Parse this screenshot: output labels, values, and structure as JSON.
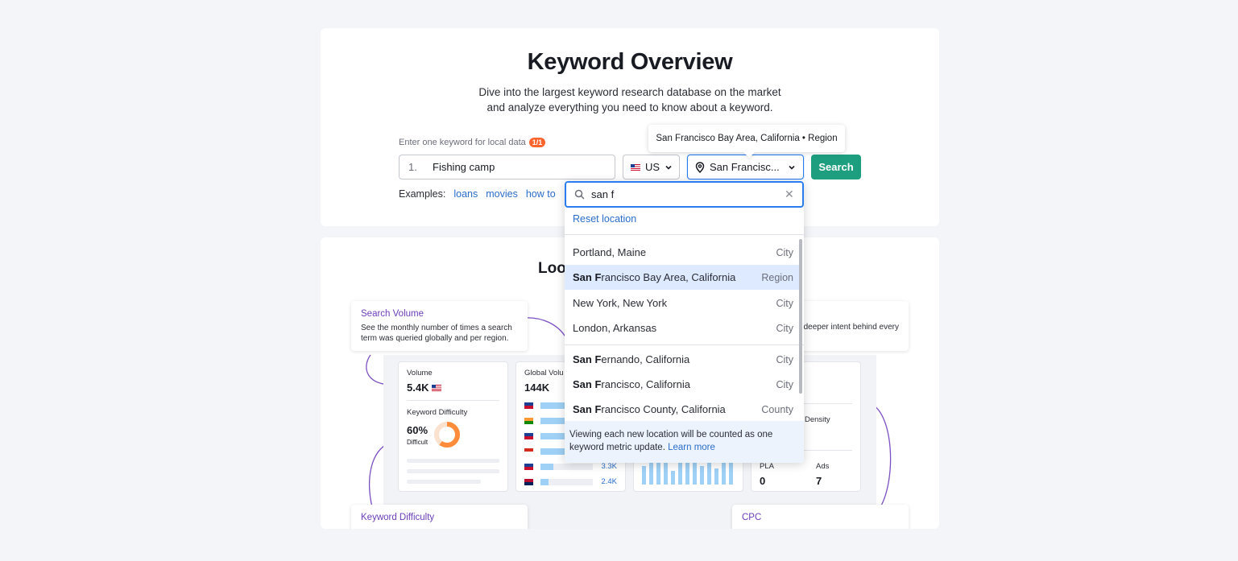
{
  "header": {
    "title": "Keyword Overview",
    "subtitle_line1": "Dive into the largest keyword research database on the market",
    "subtitle_line2": "and analyze everything you need to know about a keyword."
  },
  "form": {
    "label": "Enter one keyword for local data",
    "badge": "1/1",
    "row_number": "1.",
    "keyword_value": "Fishing camp",
    "country": "US",
    "location": "San Francisc...",
    "search_label": "Search",
    "examples_label": "Examples:",
    "examples": [
      "loans",
      "movies",
      "how to"
    ]
  },
  "tooltip": {
    "text": "San Francisco Bay Area, California • Region"
  },
  "dropdown": {
    "query": "san f",
    "reset_label": "Reset location",
    "items": [
      {
        "pre": "",
        "bold": "",
        "rest": "Portland, Maine",
        "type": "City"
      },
      {
        "pre": "",
        "bold": "San F",
        "rest": "rancisco Bay Area, California",
        "type": "Region"
      },
      {
        "pre": "",
        "bold": "",
        "rest": "New York, New York",
        "type": "City"
      },
      {
        "pre": "",
        "bold": "",
        "rest": "London, Arkansas",
        "type": "City"
      },
      {
        "pre": "",
        "bold": "San F",
        "rest": "ernando, California",
        "type": "City"
      },
      {
        "pre": "",
        "bold": "San F",
        "rest": "rancisco, California",
        "type": "City"
      },
      {
        "pre": "",
        "bold": "San F",
        "rest": "rancisco County, California",
        "type": "County"
      }
    ],
    "note_text": "Viewing each new location will be counted as one keyword metric update.",
    "note_link": "Learn more"
  },
  "bottom": {
    "title_partial": "Loo",
    "callout_sv_title": "Search Volume",
    "callout_sv_desc": "See the monthly number of times a search term was queried globally and per region.",
    "callout_intent_desc": "deeper intent behind every",
    "callout_kd_title": "Keyword Difficulty",
    "callout_cpc_title": "CPC",
    "volume_label": "Volume",
    "volume_value": "5.4K",
    "kd_label": "Keyword Difficulty",
    "kd_value": "60%",
    "kd_sub": "Difficult",
    "kd_fraction": 0.6,
    "global_label": "Global Volu",
    "global_value": "144K",
    "global_rows": [
      {
        "flag": "us",
        "fill": 0.85,
        "value": ""
      },
      {
        "flag": "in",
        "fill": 0.7,
        "value": ""
      },
      {
        "flag": "uk",
        "fill": 0.6,
        "value": ""
      },
      {
        "flag": "ca",
        "fill": 0.5,
        "value": ""
      },
      {
        "flag": "au",
        "fill": 0.25,
        "value": "3.3K"
      },
      {
        "flag": "no",
        "fill": 0.15,
        "value": "2.4K"
      }
    ],
    "trend_values": [
      7,
      9,
      8,
      9,
      5,
      9,
      8,
      9,
      7,
      9,
      6,
      8,
      9
    ],
    "density_label": "Density",
    "pla_label": "PLA",
    "pla_value": "0",
    "ads_label": "Ads",
    "ads_value": "7"
  },
  "colors": {
    "accent": "#1d9e7e",
    "link": "#2a6dc9",
    "badge": "#ff642d",
    "purple": "#6c3eb8",
    "kd_orange": "#ff8c3a"
  }
}
